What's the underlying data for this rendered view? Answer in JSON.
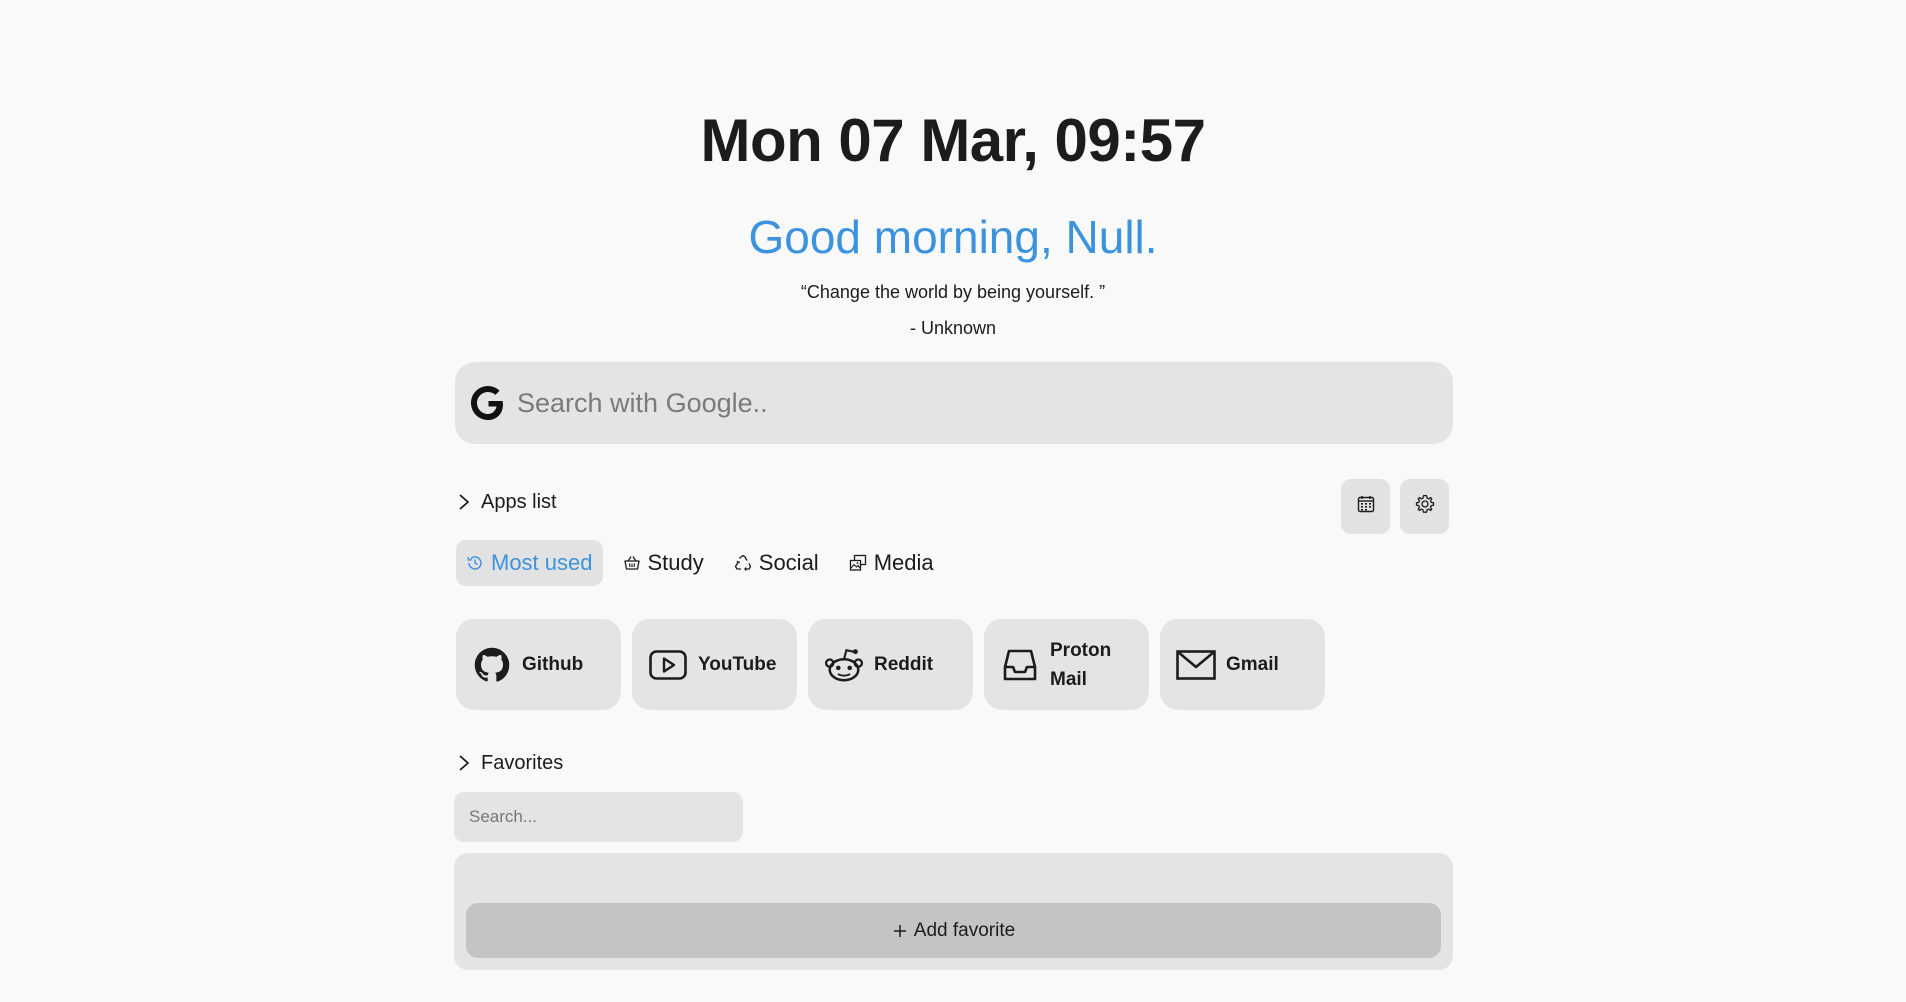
{
  "header": {
    "clock": "Mon 07 Mar, 09:57",
    "greeting": "Good morning, Null.",
    "quote": "“Change the world by being yourself. ”",
    "author": "- Unknown"
  },
  "search": {
    "placeholder": "Search with Google..",
    "engine_icon": "google-g-icon"
  },
  "apps_section": {
    "title": "Apps list",
    "toolbar": {
      "calendar_icon": "calendar-icon",
      "settings_icon": "gear-icon"
    },
    "tabs": [
      {
        "label": "Most used",
        "icon": "history-icon",
        "active": true
      },
      {
        "label": "Study",
        "icon": "basket-icon",
        "active": false
      },
      {
        "label": "Social",
        "icon": "recycle-icon",
        "active": false
      },
      {
        "label": "Media",
        "icon": "photos-icon",
        "active": false
      }
    ],
    "apps": [
      {
        "label": "Github",
        "icon": "github-icon"
      },
      {
        "label": "YouTube",
        "icon": "youtube-icon"
      },
      {
        "label": "Reddit",
        "icon": "reddit-icon"
      },
      {
        "label": "Proton Mail",
        "icon": "inbox-icon"
      },
      {
        "label": "Gmail",
        "icon": "mail-icon"
      }
    ]
  },
  "favorites_section": {
    "title": "Favorites",
    "search_placeholder": "Search...",
    "add_label": "Add favorite"
  },
  "colors": {
    "accent": "#3b93e0",
    "background": "#f9f9f9",
    "card": "#e4e4e4",
    "button": "#c4c4c4",
    "text": "#1c1c1c"
  }
}
